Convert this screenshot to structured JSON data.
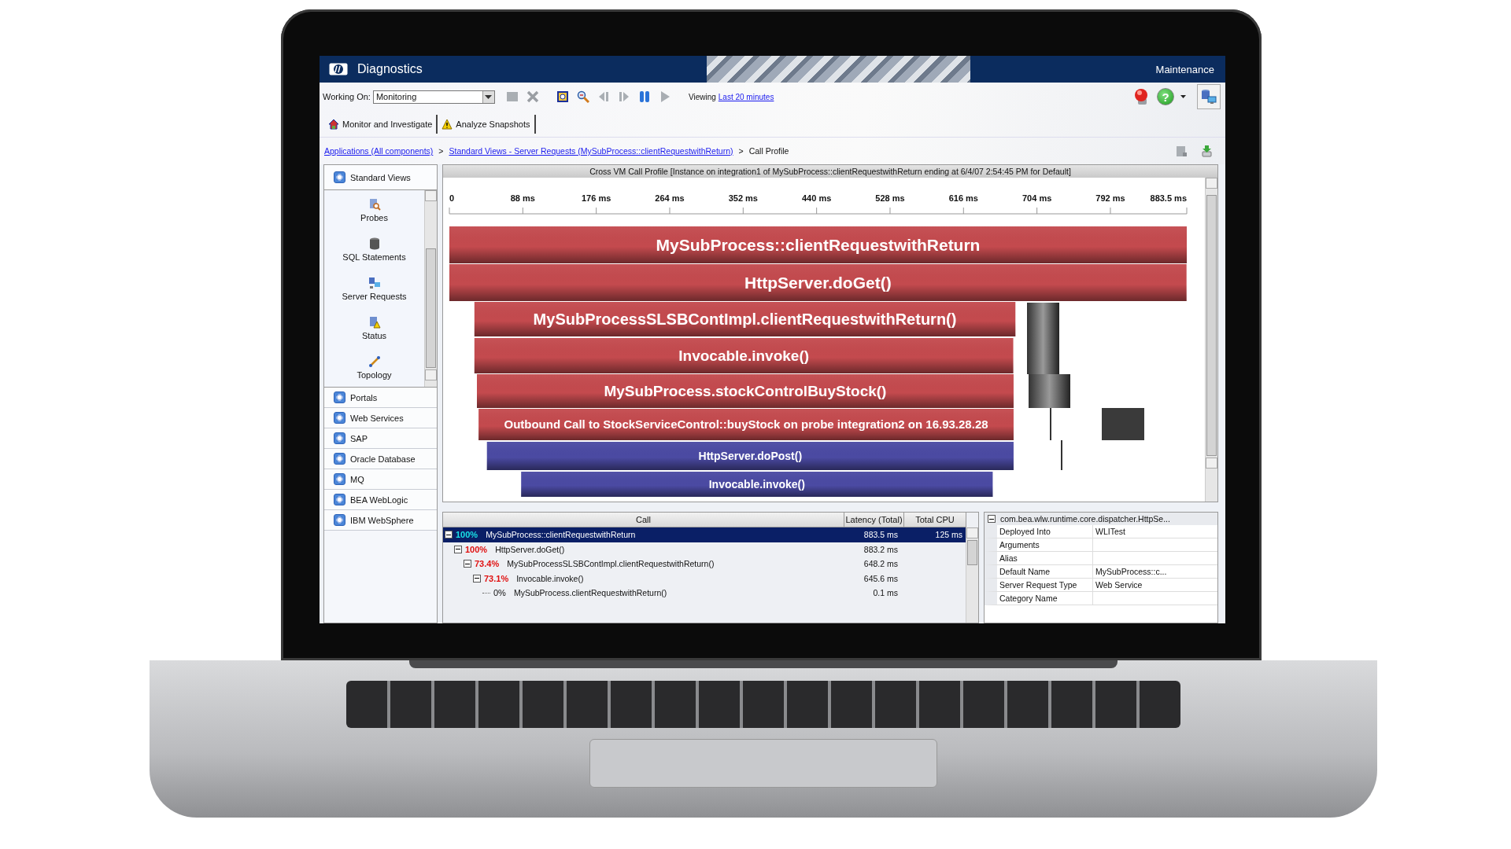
{
  "window": {
    "title": "Diagnostics",
    "section": "Maintenance"
  },
  "toolbar": {
    "working_on_label": "Working On:",
    "working_on_value": "Monitoring",
    "viewing_label": "Viewing",
    "viewing_link": "Last 20 minutes",
    "help_glyph": "?"
  },
  "tabs": [
    {
      "label": "Monitor and Investigate",
      "kind": "house"
    },
    {
      "label": "Analyze Snapshots",
      "kind": "warning"
    }
  ],
  "breadcrumb": [
    {
      "label": "Applications (All components)",
      "link": true,
      "separator": ">"
    },
    {
      "label": "Standard Views - Server Requests (MySubProcess::clientRequestwithReturn)",
      "link": true,
      "separator": ">"
    },
    {
      "label": "Call Profile",
      "link": false
    }
  ],
  "sidebar": {
    "header": "Standard Views",
    "items": [
      {
        "label": "Probes",
        "kind": "probe"
      },
      {
        "label": "SQL Statements",
        "kind": "database"
      },
      {
        "label": "Server Requests",
        "kind": "network"
      },
      {
        "label": "Status",
        "kind": "status"
      },
      {
        "label": "Topology",
        "kind": "topology"
      }
    ],
    "groups": [
      "Portals",
      "Web Services",
      "SAP",
      "Oracle Database",
      "MQ",
      "BEA WebLogic",
      "IBM WebSphere"
    ]
  },
  "call_profile": {
    "title": "Cross VM Call Profile [Instance on integration1 of MySubProcess::clientRequestwithReturn ending at 6/4/07 2:54:45 PM for Default]",
    "axis_labels": [
      "0",
      "88 ms",
      "176 ms",
      "264 ms",
      "352 ms",
      "440 ms",
      "528 ms",
      "616 ms",
      "704 ms",
      "792 ms",
      "883.5 ms"
    ],
    "bars": [
      {
        "label": "MySubProcess::clientRequestwithReturn",
        "kind": "local"
      },
      {
        "label": "HttpServer.doGet()",
        "kind": "local"
      },
      {
        "label": "MySubProcessSLSBContImpl.clientRequestwithReturn()",
        "kind": "local"
      },
      {
        "label": "Invocable.invoke()",
        "kind": "local"
      },
      {
        "label": "MySubProcess.stockControlBuyStock()",
        "kind": "local"
      },
      {
        "label": "Outbound Call to StockServiceControl::buyStock on probe integration2 on 16.93.28.28",
        "kind": "local"
      },
      {
        "label": "HttpServer.doPost()",
        "kind": "remote"
      },
      {
        "label": "Invocable.invoke()",
        "kind": "remote"
      }
    ]
  },
  "call_table": {
    "columns": [
      "Call",
      "Latency (Total)",
      "Total CPU"
    ],
    "rows": [
      {
        "percent": "100%",
        "call": "MySubProcess::clientRequestwithReturn",
        "latency": "883.5 ms",
        "cpu": "125 ms",
        "selected": true,
        "hot": true,
        "expanded": true,
        "children": [
          {
            "percent": "100%",
            "call": "HttpServer.doGet()",
            "latency": "883.2 ms",
            "selected": false,
            "hot": true,
            "expanded": true,
            "children": [
              {
                "percent": "73.4%",
                "call": "MySubProcessSLSBContImpl.clientRequestwithReturn()",
                "latency": "648.2 ms",
                "selected": false,
                "hot": true,
                "expanded": true,
                "children": [
                  {
                    "percent": "73.1%",
                    "call": "Invocable.invoke()",
                    "latency": "645.6 ms",
                    "selected": false,
                    "hot": true,
                    "expanded": true,
                    "children": [
                      {
                        "percent": "0%",
                        "call": "MySubProcess.clientRequestwithReturn()",
                        "latency": "0.1 ms",
                        "selected": false,
                        "hot": false
                      }
                    ]
                  }
                ]
              }
            ]
          }
        ]
      }
    ]
  },
  "properties": {
    "header": "com.bea.wlw.runtime.core.dispatcher.HttpSe...",
    "expanded": true,
    "rows": [
      {
        "name": "Deployed Into",
        "value": "WLITest"
      },
      {
        "name": "Arguments"
      },
      {
        "name": "Alias"
      },
      {
        "name": "Default Name",
        "value": "MySubProcess::c..."
      },
      {
        "name": "Server Request Type",
        "value": "Web Service"
      },
      {
        "name": "Category Name"
      }
    ]
  }
}
